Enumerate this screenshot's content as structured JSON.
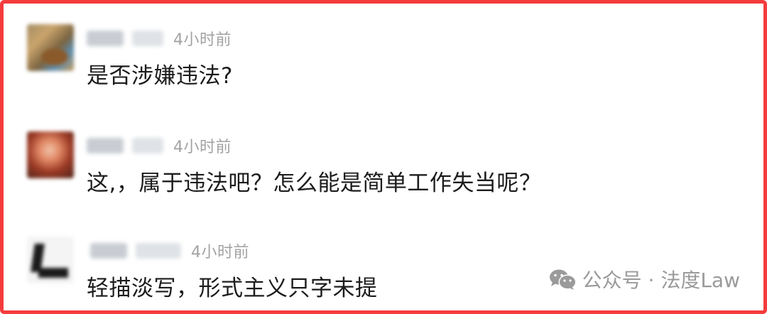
{
  "comments": [
    {
      "time": "4小时前",
      "text": "是否涉嫌违法?"
    },
    {
      "time": "4小时前",
      "text": "这,，属于违法吧？怎么能是简单工作失当呢？"
    },
    {
      "time": "4小时前",
      "text": "轻描淡写，形式主义只字未提"
    }
  ],
  "watermark": {
    "text": "公众号 · 法度Law",
    "icon": "wechat-icon"
  },
  "colors": {
    "border": "#f43c3c",
    "time": "#a2a2a2",
    "text": "#1c1c1c",
    "watermark": "#9a9a9a"
  }
}
